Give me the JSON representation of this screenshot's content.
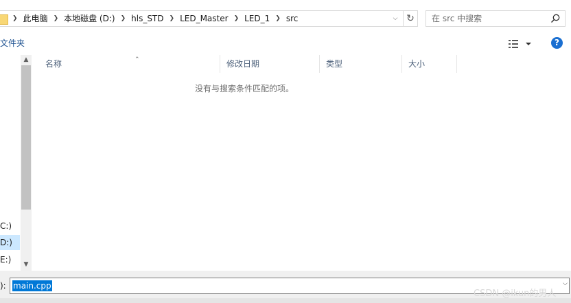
{
  "address_bar": {
    "crumbs": [
      "此电脑",
      "本地磁盘 (D:)",
      "hls_STD",
      "LED_Master",
      "LED_1",
      "src"
    ]
  },
  "search": {
    "placeholder": "在 src 中搜索"
  },
  "toolbar": {
    "new_folder_label": "文件夹",
    "help_label": "?"
  },
  "nav": {
    "drives": [
      {
        "label": "C:)",
        "selected": false
      },
      {
        "label": "D:)",
        "selected": true
      },
      {
        "label": "E:)",
        "selected": false
      }
    ]
  },
  "columns": [
    "名称",
    "修改日期",
    "类型",
    "大小"
  ],
  "empty_message": "没有与搜索条件匹配的项。",
  "file_name": {
    "label": "):",
    "value": "main.cpp"
  },
  "watermark": "CSDN @ikun的男人",
  "colors": {
    "accent": "#0078d7",
    "selection": "#cce8ff",
    "help": "#1a6fd1"
  },
  "icons": [
    "folder-icon",
    "chevron-right-icon",
    "chevron-down-icon",
    "refresh-icon",
    "search-icon",
    "view-options-icon",
    "help-icon",
    "scroll-up-icon",
    "scroll-down-icon"
  ]
}
